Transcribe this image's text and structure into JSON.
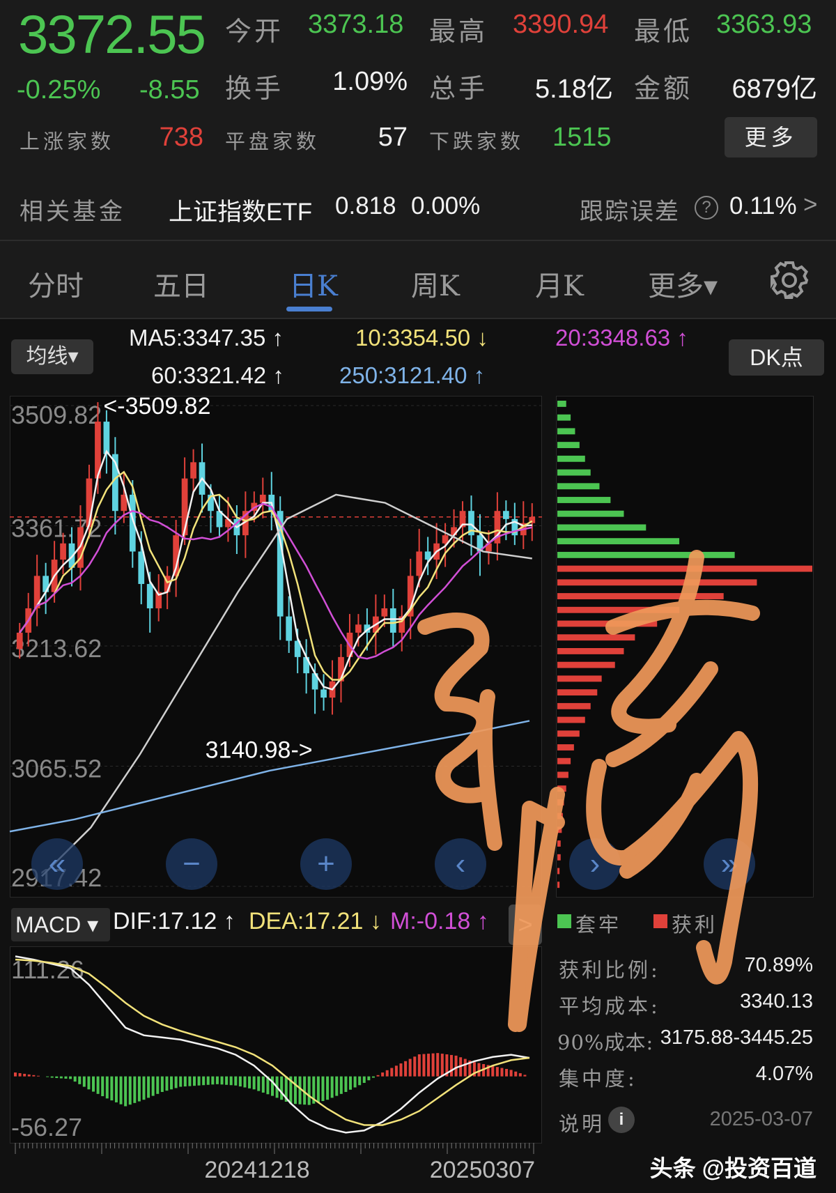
{
  "quote": {
    "price": "3372.55",
    "change_pct": "-0.25%",
    "change": "-8.55",
    "open_label": "今开",
    "open": "3373.18",
    "high_label": "最高",
    "high": "3390.94",
    "low_label": "最低",
    "low": "3363.93",
    "turnover_label": "换手",
    "turnover": "1.09%",
    "volume_label": "总手",
    "volume": "5.18亿",
    "amount_label": "金额",
    "amount": "6879亿",
    "up_label": "上涨家数",
    "up": "738",
    "flat_label": "平盘家数",
    "flat": "57",
    "down_label": "下跌家数",
    "down": "1515",
    "more_label": "更多"
  },
  "fund": {
    "label": "相关基金",
    "name": "上证指数ETF",
    "price": "0.818",
    "pct": "0.00%",
    "tracking_label": "跟踪误差",
    "tracking": "0.11%",
    "chevron": ">"
  },
  "tabs": [
    {
      "label": "分时"
    },
    {
      "label": "五日"
    },
    {
      "label": "日K",
      "active": true
    },
    {
      "label": "周K"
    },
    {
      "label": "月K"
    },
    {
      "label": "更多▾"
    }
  ],
  "ma": {
    "selector": "均线▾",
    "ma5": "MA5:3347.35 ↑",
    "ma10": "10:3354.50 ↓",
    "ma20": "20:3348.63 ↑",
    "ma60": "60:3321.42 ↑",
    "ma250": "250:3121.40 ↑",
    "dk": "DK点"
  },
  "macd": {
    "selector": "MACD ▾",
    "dif": "DIF:17.12 ↑",
    "dea": "DEA:17.21 ↓",
    "m": "M:-0.18 ↑",
    "next": ">"
  },
  "chips": {
    "trapped_label": "套牢",
    "profit_label": "获利",
    "profit_ratio_label": "获利比例:",
    "profit_ratio": "70.89%",
    "avg_cost_label": "平均成本:",
    "avg_cost": "3340.13",
    "cost90_label": "90%成本:",
    "cost90": "3175.88-3445.25",
    "concentration_label": "集中度:",
    "concentration": "4.07%",
    "help_label": "说明",
    "date": "2025-03-07"
  },
  "watermark": "头条 @投资百道",
  "colors": {
    "up": "#e0413a",
    "down": "#4cc552",
    "ma5": "#f2f2f2",
    "ma10": "#f2e27a",
    "ma20": "#d14fd6",
    "ma60": "#cfcfcf",
    "ma250": "#7fb3e8",
    "accent": "#4a7fd0",
    "signature": "#f0995a"
  },
  "chart_data": [
    {
      "type": "candlestick",
      "y_ticks": [
        "3509.82",
        "3361.72",
        "3213.62",
        "3065.52",
        "2917.42"
      ],
      "ylim": [
        2917.42,
        3509.82
      ],
      "x_ticks": [
        "20241218",
        "20250307"
      ],
      "annotations": {
        "high": "<-3509.82",
        "low": "3140.98->"
      },
      "closes": [
        3230,
        3260,
        3300,
        3280,
        3320,
        3340,
        3310,
        3360,
        3420,
        3490,
        3450,
        3380,
        3400,
        3330,
        3290,
        3260,
        3280,
        3300,
        3350,
        3420,
        3440,
        3400,
        3380,
        3360,
        3370,
        3350,
        3380,
        3390,
        3400,
        3380,
        3250,
        3220,
        3200,
        3180,
        3160,
        3150,
        3170,
        3200,
        3230,
        3240,
        3230,
        3250,
        3260,
        3230,
        3250,
        3300,
        3330,
        3320,
        3340,
        3350,
        3360,
        3380,
        3350,
        3330,
        3340,
        3380,
        3370,
        3350,
        3365,
        3372.55
      ],
      "ma60": [
        2930,
        2990,
        3080,
        3180,
        3280,
        3370,
        3400,
        3390,
        3360,
        3330,
        3321.42
      ],
      "ma250": [
        2985,
        3000,
        3020,
        3040,
        3060,
        3075,
        3090,
        3105,
        3121.4
      ]
    },
    {
      "type": "bar+line",
      "name": "MACD",
      "y_ticks": [
        "111.26",
        "-56.27"
      ],
      "ylim": [
        -56.27,
        111.26
      ],
      "dif": [
        111,
        108,
        104,
        100,
        85,
        65,
        45,
        38,
        36,
        34,
        30,
        26,
        20,
        10,
        -5,
        -25,
        -40,
        -48,
        -52,
        -50,
        -42,
        -30,
        -15,
        -2,
        8,
        14,
        18,
        20,
        17.12
      ],
      "dea": [
        108,
        107,
        105,
        102,
        95,
        82,
        68,
        56,
        48,
        42,
        37,
        32,
        27,
        20,
        10,
        -4,
        -18,
        -30,
        -40,
        -45,
        -45,
        -40,
        -32,
        -20,
        -8,
        3,
        10,
        15,
        17.21
      ]
    },
    {
      "type": "horizontal-bar",
      "name": "chips",
      "split_index": 12,
      "values": [
        8,
        12,
        16,
        20,
        25,
        30,
        38,
        48,
        60,
        80,
        110,
        160,
        230,
        180,
        150,
        110,
        90,
        70,
        60,
        52,
        40,
        36,
        30,
        25,
        20,
        15,
        12,
        10,
        8,
        6,
        5,
        4,
        3,
        3,
        2,
        2
      ]
    }
  ]
}
